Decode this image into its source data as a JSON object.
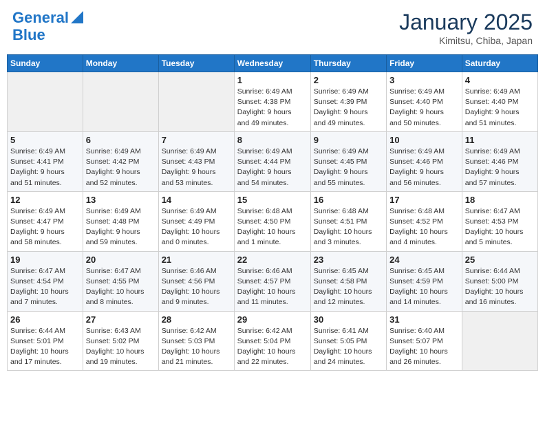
{
  "header": {
    "logo_line1": "General",
    "logo_line2": "Blue",
    "month": "January 2025",
    "location": "Kimitsu, Chiba, Japan"
  },
  "weekdays": [
    "Sunday",
    "Monday",
    "Tuesday",
    "Wednesday",
    "Thursday",
    "Friday",
    "Saturday"
  ],
  "weeks": [
    [
      {
        "day": "",
        "info": ""
      },
      {
        "day": "",
        "info": ""
      },
      {
        "day": "",
        "info": ""
      },
      {
        "day": "1",
        "info": "Sunrise: 6:49 AM\nSunset: 4:38 PM\nDaylight: 9 hours\nand 49 minutes."
      },
      {
        "day": "2",
        "info": "Sunrise: 6:49 AM\nSunset: 4:39 PM\nDaylight: 9 hours\nand 49 minutes."
      },
      {
        "day": "3",
        "info": "Sunrise: 6:49 AM\nSunset: 4:40 PM\nDaylight: 9 hours\nand 50 minutes."
      },
      {
        "day": "4",
        "info": "Sunrise: 6:49 AM\nSunset: 4:40 PM\nDaylight: 9 hours\nand 51 minutes."
      }
    ],
    [
      {
        "day": "5",
        "info": "Sunrise: 6:49 AM\nSunset: 4:41 PM\nDaylight: 9 hours\nand 51 minutes."
      },
      {
        "day": "6",
        "info": "Sunrise: 6:49 AM\nSunset: 4:42 PM\nDaylight: 9 hours\nand 52 minutes."
      },
      {
        "day": "7",
        "info": "Sunrise: 6:49 AM\nSunset: 4:43 PM\nDaylight: 9 hours\nand 53 minutes."
      },
      {
        "day": "8",
        "info": "Sunrise: 6:49 AM\nSunset: 4:44 PM\nDaylight: 9 hours\nand 54 minutes."
      },
      {
        "day": "9",
        "info": "Sunrise: 6:49 AM\nSunset: 4:45 PM\nDaylight: 9 hours\nand 55 minutes."
      },
      {
        "day": "10",
        "info": "Sunrise: 6:49 AM\nSunset: 4:46 PM\nDaylight: 9 hours\nand 56 minutes."
      },
      {
        "day": "11",
        "info": "Sunrise: 6:49 AM\nSunset: 4:46 PM\nDaylight: 9 hours\nand 57 minutes."
      }
    ],
    [
      {
        "day": "12",
        "info": "Sunrise: 6:49 AM\nSunset: 4:47 PM\nDaylight: 9 hours\nand 58 minutes."
      },
      {
        "day": "13",
        "info": "Sunrise: 6:49 AM\nSunset: 4:48 PM\nDaylight: 9 hours\nand 59 minutes."
      },
      {
        "day": "14",
        "info": "Sunrise: 6:49 AM\nSunset: 4:49 PM\nDaylight: 10 hours\nand 0 minutes."
      },
      {
        "day": "15",
        "info": "Sunrise: 6:48 AM\nSunset: 4:50 PM\nDaylight: 10 hours\nand 1 minute."
      },
      {
        "day": "16",
        "info": "Sunrise: 6:48 AM\nSunset: 4:51 PM\nDaylight: 10 hours\nand 3 minutes."
      },
      {
        "day": "17",
        "info": "Sunrise: 6:48 AM\nSunset: 4:52 PM\nDaylight: 10 hours\nand 4 minutes."
      },
      {
        "day": "18",
        "info": "Sunrise: 6:47 AM\nSunset: 4:53 PM\nDaylight: 10 hours\nand 5 minutes."
      }
    ],
    [
      {
        "day": "19",
        "info": "Sunrise: 6:47 AM\nSunset: 4:54 PM\nDaylight: 10 hours\nand 7 minutes."
      },
      {
        "day": "20",
        "info": "Sunrise: 6:47 AM\nSunset: 4:55 PM\nDaylight: 10 hours\nand 8 minutes."
      },
      {
        "day": "21",
        "info": "Sunrise: 6:46 AM\nSunset: 4:56 PM\nDaylight: 10 hours\nand 9 minutes."
      },
      {
        "day": "22",
        "info": "Sunrise: 6:46 AM\nSunset: 4:57 PM\nDaylight: 10 hours\nand 11 minutes."
      },
      {
        "day": "23",
        "info": "Sunrise: 6:45 AM\nSunset: 4:58 PM\nDaylight: 10 hours\nand 12 minutes."
      },
      {
        "day": "24",
        "info": "Sunrise: 6:45 AM\nSunset: 4:59 PM\nDaylight: 10 hours\nand 14 minutes."
      },
      {
        "day": "25",
        "info": "Sunrise: 6:44 AM\nSunset: 5:00 PM\nDaylight: 10 hours\nand 16 minutes."
      }
    ],
    [
      {
        "day": "26",
        "info": "Sunrise: 6:44 AM\nSunset: 5:01 PM\nDaylight: 10 hours\nand 17 minutes."
      },
      {
        "day": "27",
        "info": "Sunrise: 6:43 AM\nSunset: 5:02 PM\nDaylight: 10 hours\nand 19 minutes."
      },
      {
        "day": "28",
        "info": "Sunrise: 6:42 AM\nSunset: 5:03 PM\nDaylight: 10 hours\nand 21 minutes."
      },
      {
        "day": "29",
        "info": "Sunrise: 6:42 AM\nSunset: 5:04 PM\nDaylight: 10 hours\nand 22 minutes."
      },
      {
        "day": "30",
        "info": "Sunrise: 6:41 AM\nSunset: 5:05 PM\nDaylight: 10 hours\nand 24 minutes."
      },
      {
        "day": "31",
        "info": "Sunrise: 6:40 AM\nSunset: 5:07 PM\nDaylight: 10 hours\nand 26 minutes."
      },
      {
        "day": "",
        "info": ""
      }
    ]
  ]
}
